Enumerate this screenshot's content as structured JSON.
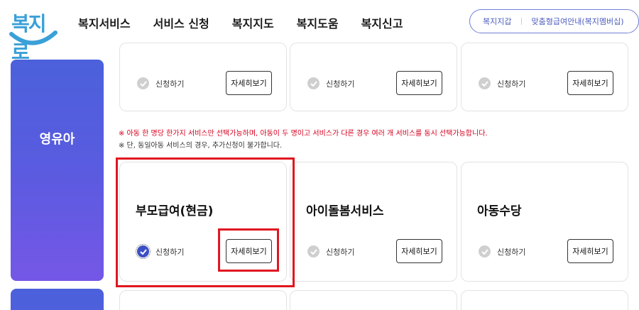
{
  "logo": {
    "text": "복지로"
  },
  "nav": {
    "items": [
      "복지서비스",
      "서비스 신청",
      "복지지도",
      "복지도움",
      "복지신고"
    ]
  },
  "util_links": [
    "복지지갑",
    "맞춤형급여안내(복지멤버십)"
  ],
  "sidebar": {
    "current_label": "영유아"
  },
  "top_cards": [
    {
      "apply_label": "신청하기",
      "detail_label": "자세히보기"
    },
    {
      "apply_label": "신청하기",
      "detail_label": "자세히보기"
    },
    {
      "apply_label": "신청하기",
      "detail_label": "자세히보기"
    }
  ],
  "notices": {
    "red": "※ 아동 한 명당 한가지 서비스만 선택가능하며, 아동이 두 명이고 서비스가 다른 경우 여러 개 서비스를 동시 선택가능합니다.",
    "dark": "※ 단, 동일아동 서비스의 경우, 추가신청이 불가합니다."
  },
  "service_cards": [
    {
      "title": "부모급여(현금)",
      "apply_label": "신청하기",
      "detail_label": "자세히보기",
      "checked": true
    },
    {
      "title": "아이돌봄서비스",
      "apply_label": "신청하기",
      "detail_label": "자세히보기",
      "checked": false
    },
    {
      "title": "아동수당",
      "apply_label": "신청하기",
      "detail_label": "자세히보기",
      "checked": false
    }
  ],
  "colors": {
    "accent": "#4b61db",
    "highlight": "#e0171f",
    "notice_red": "#d4001e",
    "logo": "#3aa0d8"
  }
}
